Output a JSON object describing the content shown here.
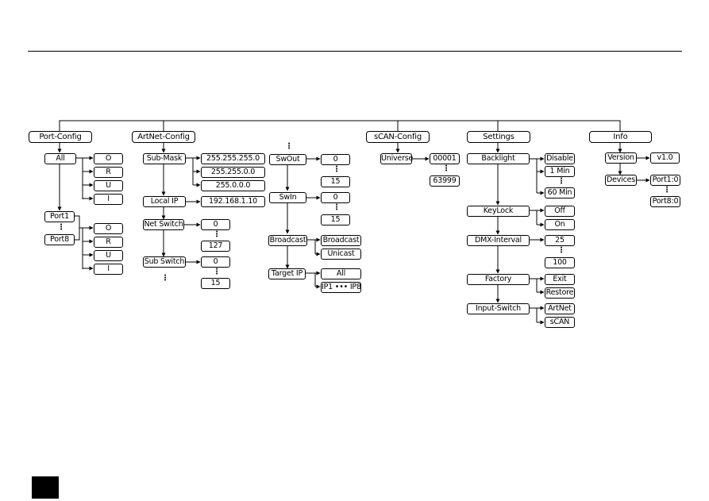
{
  "diagram": {
    "categories": [
      {
        "label": "Port-Config",
        "items": [
          {
            "label": "All",
            "options": [
              "O",
              "R",
              "U",
              "I"
            ]
          },
          {
            "label": "Port1",
            "range_end": "Port8",
            "options": [
              "O",
              "R",
              "U",
              "I"
            ]
          }
        ]
      },
      {
        "label": "ArtNet-Config",
        "items": [
          {
            "label": "Sub-Mask",
            "options": [
              "255.255.255.0",
              "255.255.0.0",
              "255.0.0.0"
            ]
          },
          {
            "label": "Local IP",
            "options": [
              "192.168.1.10"
            ]
          },
          {
            "label": "Net Switch",
            "range": [
              "0",
              "127"
            ]
          },
          {
            "label": "Sub Switch",
            "range": [
              "0",
              "15"
            ]
          },
          {
            "label": "SwOut",
            "range": [
              "0",
              "15"
            ]
          },
          {
            "label": "SwIn",
            "range": [
              "0",
              "15"
            ]
          },
          {
            "label": "Broadcast",
            "options": [
              "Broadcast",
              "Unicast"
            ]
          },
          {
            "label": "Target IP",
            "options": [
              "All",
              "IP1 ••• IP8"
            ]
          }
        ]
      },
      {
        "label": "sCAN-Config",
        "items": [
          {
            "label": "Universe",
            "range": [
              "00001",
              "63999"
            ]
          }
        ]
      },
      {
        "label": "Settings",
        "items": [
          {
            "label": "Backlight",
            "options": [
              "Disable",
              "1 Min",
              "60 Min"
            ]
          },
          {
            "label": "KeyLock",
            "options": [
              "Off",
              "On"
            ]
          },
          {
            "label": "DMX-Interval",
            "range": [
              "25",
              "100"
            ]
          },
          {
            "label": "Factory",
            "options": [
              "Exit",
              "Restore"
            ]
          },
          {
            "label": "Input-Switch",
            "options": [
              "ArtNet",
              "sCAN"
            ]
          }
        ]
      },
      {
        "label": "Info",
        "items": [
          {
            "label": "Version",
            "options": [
              "v1.0"
            ]
          },
          {
            "label": "Devices",
            "range": [
              "Port1:0",
              "Port8:0"
            ]
          }
        ]
      }
    ],
    "ellipsis": "⋮"
  }
}
